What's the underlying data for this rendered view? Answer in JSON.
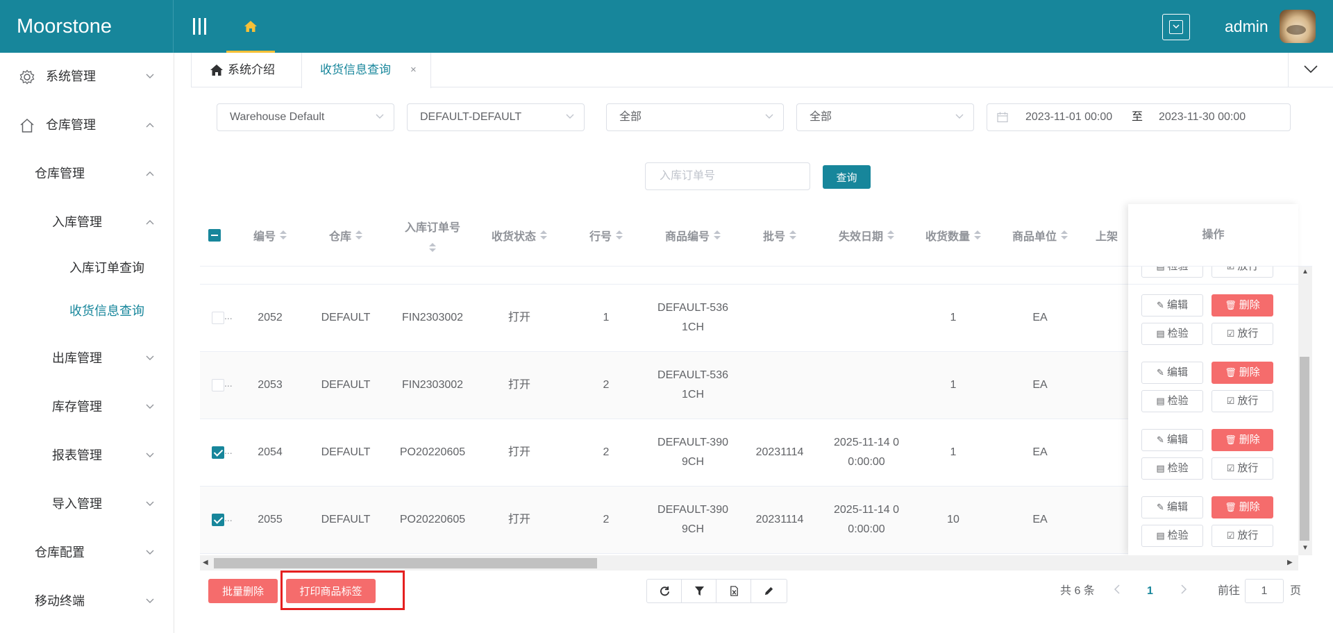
{
  "app": {
    "brand": "Moorstone",
    "username": "admin"
  },
  "colors": {
    "primary": "#17869b",
    "danger": "#f56c6c",
    "home_underline": "#f5c037",
    "highlight": "#e52020"
  },
  "sidebar": {
    "items": [
      {
        "label": "系统管理",
        "icon": "gear-icon",
        "expanded": false
      },
      {
        "label": "仓库管理",
        "icon": "home-outline-icon",
        "expanded": true
      },
      {
        "label": "仓库管理",
        "expanded": true
      },
      {
        "label": "入库管理",
        "expanded": true
      },
      {
        "label": "入库订单查询"
      },
      {
        "label": "收货信息查询",
        "active": true
      },
      {
        "label": "出库管理",
        "expanded": false
      },
      {
        "label": "库存管理",
        "expanded": false
      },
      {
        "label": "报表管理",
        "expanded": false
      },
      {
        "label": "导入管理",
        "expanded": false
      },
      {
        "label": "仓库配置",
        "expanded": false
      },
      {
        "label": "移动终端",
        "expanded": false
      }
    ]
  },
  "tabs": [
    {
      "label": "系统介绍",
      "icon": "home-icon"
    },
    {
      "label": "收货信息查询",
      "active": true,
      "close": "×"
    }
  ],
  "filters": {
    "warehouse": "Warehouse Default",
    "owner": "DEFAULT-DEFAULT",
    "status1": "全部",
    "status2": "全部",
    "date_start": "2023-11-01 00:00",
    "date_sep": "至",
    "date_end": "2023-11-30 00:00",
    "order_placeholder": "入库订单号",
    "query_label": "查询"
  },
  "table": {
    "headers": {
      "id": "编号",
      "warehouse": "仓库",
      "order_no": "入库订单号",
      "status": "收货状态",
      "line": "行号",
      "sku": "商品编号",
      "batch": "批号",
      "expiry": "失效日期",
      "qty": "收货数量",
      "unit": "商品单位",
      "shelf": "上架",
      "ops": "操作"
    },
    "rows": [
      {
        "checked": false,
        "id": "2052",
        "warehouse": "DEFAULT",
        "order_no": "FIN2303002",
        "status": "打开",
        "line": "1",
        "sku1": "DEFAULT-536",
        "sku2": "1CH",
        "batch": "",
        "exp1": "",
        "exp2": "",
        "qty": "1",
        "unit": "EA"
      },
      {
        "checked": false,
        "id": "2053",
        "warehouse": "DEFAULT",
        "order_no": "FIN2303002",
        "status": "打开",
        "line": "2",
        "sku1": "DEFAULT-536",
        "sku2": "1CH",
        "batch": "",
        "exp1": "",
        "exp2": "",
        "qty": "1",
        "unit": "EA"
      },
      {
        "checked": true,
        "id": "2054",
        "warehouse": "DEFAULT",
        "order_no": "PO20220605",
        "status": "打开",
        "line": "2",
        "sku1": "DEFAULT-390",
        "sku2": "9CH",
        "batch": "20231114",
        "exp1": "2025-11-14 0",
        "exp2": "0:00:00",
        "qty": "1",
        "unit": "EA"
      },
      {
        "checked": true,
        "id": "2055",
        "warehouse": "DEFAULT",
        "order_no": "PO20220605",
        "status": "打开",
        "line": "2",
        "sku1": "DEFAULT-390",
        "sku2": "9CH",
        "batch": "20231114",
        "exp1": "2025-11-14 0",
        "exp2": "0:00:00",
        "qty": "10",
        "unit": "EA"
      }
    ],
    "op_labels": {
      "edit": "编辑",
      "delete": "删除",
      "inspect": "检验",
      "release": "放行"
    },
    "truncation": "..."
  },
  "footer": {
    "bulk_delete": "批量删除",
    "print_labels": "打印商品标签",
    "tools": [
      "refresh-icon",
      "filter-icon",
      "excel-export-icon",
      "edit-icon"
    ],
    "total": "共 6 条",
    "current_page": "1",
    "goto_label": "前往",
    "goto_value": "1",
    "page_suffix": "页"
  }
}
